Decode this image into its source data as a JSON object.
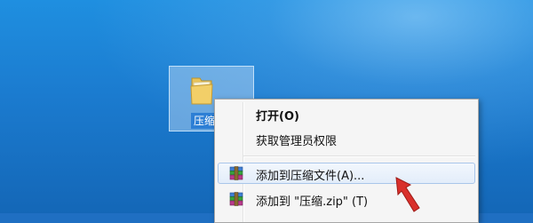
{
  "desktop": {
    "folder": {
      "label": "压缩",
      "icon": "folder-icon"
    }
  },
  "context_menu": {
    "items": [
      {
        "label": "打开(O)",
        "bold": true,
        "icon": ""
      },
      {
        "label": "获取管理员权限",
        "bold": false,
        "icon": ""
      },
      {
        "label": "添加到压缩文件(A)...",
        "bold": false,
        "icon": "winrar-icon",
        "highlighted": true
      },
      {
        "label": "添加到 \"压缩.zip\" (T)",
        "bold": false,
        "icon": "winrar-icon"
      }
    ]
  },
  "colors": {
    "desktop_blue": "#1b7bcf",
    "menu_background": "#f5f5f5",
    "highlight_border": "#a9c6ea",
    "arrow_red": "#d9302b"
  }
}
